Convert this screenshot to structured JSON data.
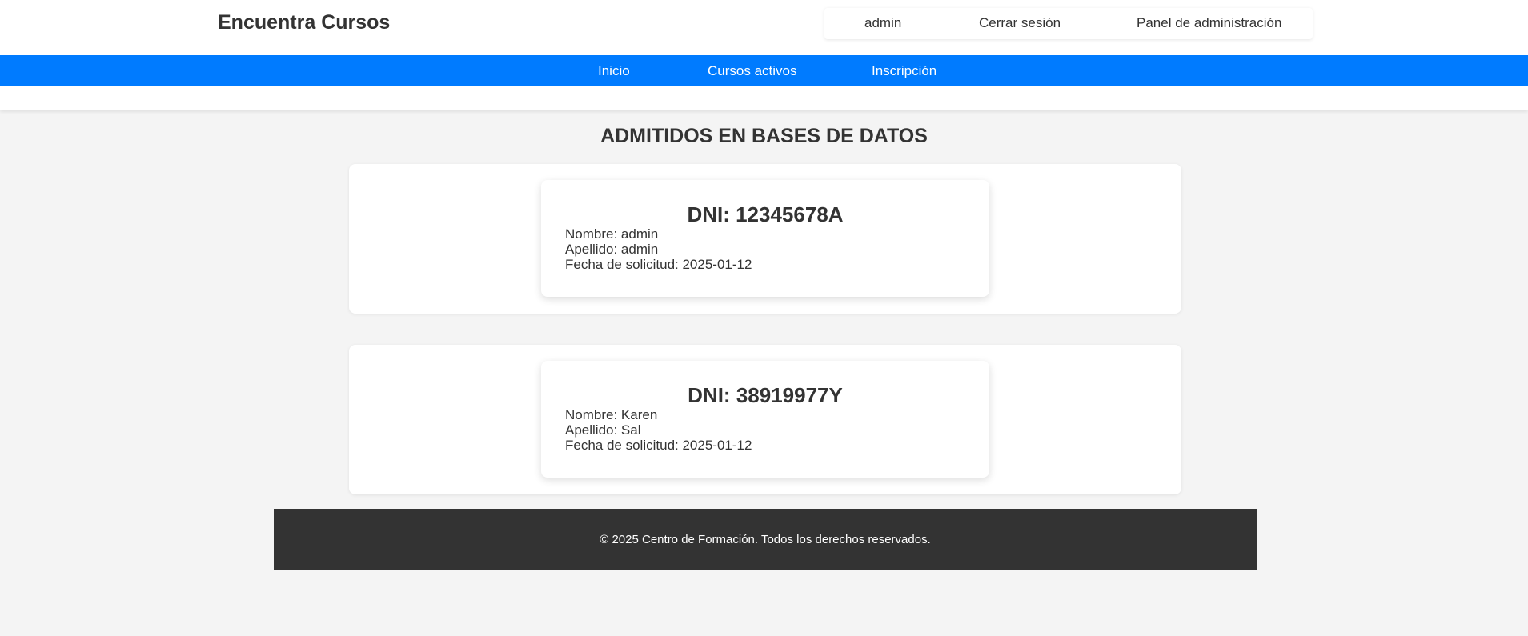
{
  "header": {
    "brand": "Encuentra Cursos",
    "user_menu": {
      "username": "admin",
      "logout": "Cerrar sesión",
      "admin_panel": "Panel de administración"
    }
  },
  "nav": {
    "items": [
      {
        "label": "Inicio"
      },
      {
        "label": "Cursos activos"
      },
      {
        "label": "Inscripción"
      }
    ]
  },
  "main": {
    "title": "ADMITIDOS EN BASES DE DATOS",
    "records": [
      {
        "dni": "DNI: 12345678A",
        "nombre": "Nombre: admin",
        "apellido": "Apellido: admin",
        "fecha": "Fecha de solicitud: 2025-01-12"
      },
      {
        "dni": "DNI: 38919977Y",
        "nombre": "Nombre: Karen",
        "apellido": "Apellido: Sal",
        "fecha": "Fecha de solicitud: 2025-01-12"
      }
    ]
  },
  "footer": {
    "text": "© 2025 Centro de Formación. Todos los derechos reservados."
  },
  "colors": {
    "nav_bg": "#007bff",
    "footer_bg": "#333333",
    "page_bg": "#f4f4f4"
  }
}
